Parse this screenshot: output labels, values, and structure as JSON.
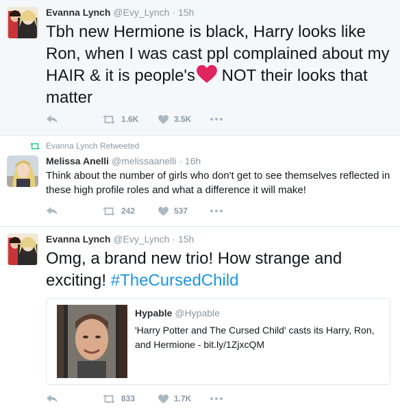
{
  "tweets": [
    {
      "name": "Evanna Lynch",
      "handle": "@Evy_Lynch",
      "time": "15h",
      "text_before": "Tbh new Hermione is black, Harry looks like Ron, when I was cast ppl complained about my HAIR & it is people's",
      "text_after": " NOT their looks that matter",
      "retweets": "1.6K",
      "likes": "3.5K"
    },
    {
      "retweet_context": "Evanna Lynch Retweeted",
      "name": "Melissa Anelli",
      "handle": "@melissaanelli",
      "time": "16h",
      "text": "Think about the number of girls who don't get to see themselves reflected in these  high profile roles and what a difference it will make!",
      "retweets": "242",
      "likes": "537"
    },
    {
      "name": "Evanna Lynch",
      "handle": "@Evy_Lynch",
      "time": "15h",
      "text": "Omg, a brand new trio! How strange and exciting! ",
      "hashtag": "#TheCursedChild",
      "quote": {
        "name": "Hypable",
        "handle": "@Hypable",
        "text": "'Harry Potter and The Cursed Child' casts its Harry, Ron, and Hermione - bit.ly/1ZjxcQM"
      },
      "retweets": "833",
      "likes": "1.7K"
    }
  ],
  "separator": "·",
  "icons": {
    "reply": "reply-icon",
    "retweet": "retweet-icon",
    "like": "heart-icon",
    "more": "more-icon",
    "inline_heart": "red-heart-emoji"
  },
  "colors": {
    "muted": "#8899a6",
    "link": "#1b95e0",
    "retweet_green": "#19cf86",
    "heart_red": "#e0245e"
  }
}
